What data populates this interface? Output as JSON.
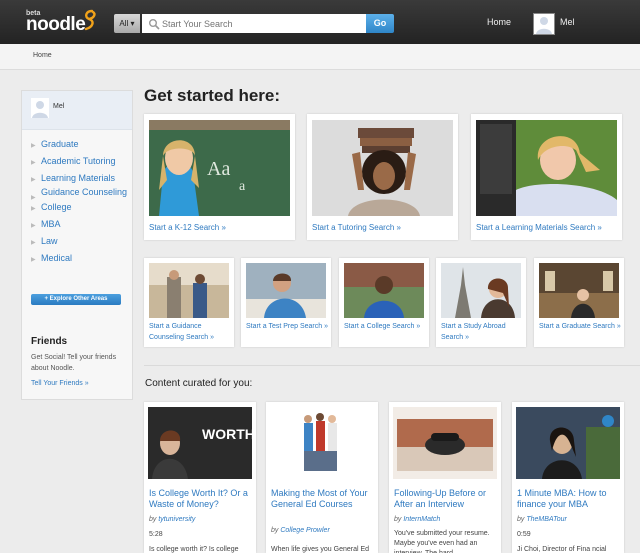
{
  "header": {
    "logo_beta": "beta",
    "logo_text": "noodle",
    "search_scope": "All ▾",
    "search_placeholder": "Start Your Search",
    "go_label": "Go",
    "nav_home": "Home",
    "user_name": "Mel"
  },
  "breadcrumb": {
    "home": "Home"
  },
  "sidebar": {
    "user_name": "Mel",
    "items": [
      {
        "label": "Graduate"
      },
      {
        "label": "Academic Tutoring"
      },
      {
        "label": "Learning Materials"
      },
      {
        "label": "Guidance Counseling"
      },
      {
        "label": "College"
      },
      {
        "label": "MBA"
      },
      {
        "label": "Law"
      },
      {
        "label": "Medical"
      }
    ],
    "explore_label": "+ Explore Other Areas",
    "friends_title": "Friends",
    "friends_text": "Get Social! Tell your friends about Noodle.",
    "friends_link": "Tell Your Friends »"
  },
  "main": {
    "heading": "Get started here:",
    "big_cards": [
      {
        "label": "Start a K-12 Search »"
      },
      {
        "label": "Start a Tutoring Search »"
      },
      {
        "label": "Start a Learning Materials Search »"
      }
    ],
    "small_cards": [
      {
        "label": "Start a Guidance Counseling Search »"
      },
      {
        "label": "Start a Test Prep Search »"
      },
      {
        "label": "Start a College Search »"
      },
      {
        "label": "Start a Study Abroad Search »"
      },
      {
        "label": "Start a Graduate Search »"
      }
    ],
    "curated_heading": "Content curated for you:",
    "content": [
      {
        "title": "Is College Worth It? Or a Waste of Money?",
        "by_prefix": "by",
        "author": "tytuniversity",
        "meta": "5:28",
        "desc": "Is college worth it? Is college",
        "thumb_text": "WORTH IT?"
      },
      {
        "title": "Making the Most of Your General Ed Courses",
        "by_prefix": "by",
        "author": "College Prowler",
        "meta": "",
        "desc": "When life gives you General Ed",
        "thumb_text": ""
      },
      {
        "title": "Following-Up Before or After an Interview",
        "by_prefix": "by",
        "author": "InternMatch",
        "meta": "",
        "desc": "You've submitted your resume. Maybe you've even had an interview. The hard",
        "thumb_text": ""
      },
      {
        "title": "1 Minute MBA: How to finance your MBA",
        "by_prefix": "by",
        "author": "TheMBATour",
        "meta": "0:59",
        "desc": "Ji Choi, Director of Fina ncial",
        "thumb_text": ""
      }
    ]
  },
  "colors": {
    "link": "#2f7ac0",
    "topbar": "#2b2b2b",
    "go_button": "#3a91d3"
  }
}
